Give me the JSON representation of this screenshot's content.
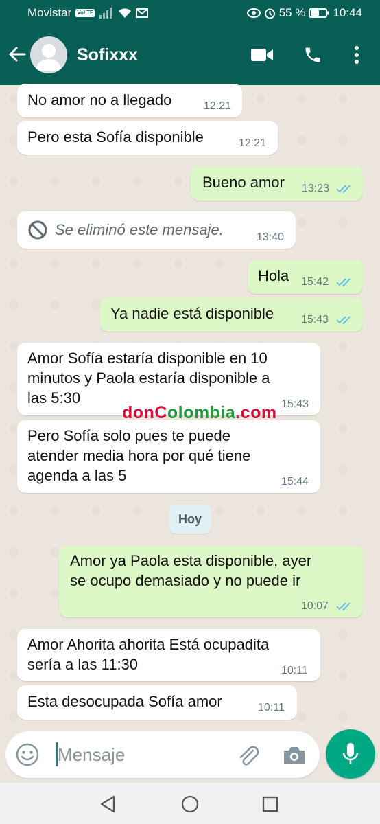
{
  "status_bar": {
    "carrier": "Movistar",
    "network_badge": "VoLTE",
    "battery_percent": "55 %",
    "time": "10:44",
    "icons": [
      "signal-icon",
      "wifi-icon",
      "mail-icon",
      "eye-icon",
      "alarm-icon",
      "battery-icon"
    ]
  },
  "header": {
    "contact_name": "Sofixxx",
    "icons": [
      "back-arrow-icon",
      "avatar-icon",
      "video-call-icon",
      "phone-icon",
      "more-vert-icon"
    ]
  },
  "messages": [
    {
      "text": "No amor no a llegado",
      "time": "12:21",
      "direction": "in"
    },
    {
      "text": "Pero esta Sofía disponible",
      "time": "12:21",
      "direction": "in"
    },
    {
      "text": "Bueno amor",
      "time": "13:23",
      "direction": "out",
      "status": "read"
    },
    {
      "text": "Se eliminó este mensaje.",
      "time": "13:40",
      "direction": "in",
      "deleted": true
    },
    {
      "text": "Hola",
      "time": "15:42",
      "direction": "out",
      "status": "read"
    },
    {
      "text": "Ya nadie está disponible",
      "time": "15:43",
      "direction": "out",
      "status": "read"
    },
    {
      "lines": [
        "Amor Sofía estaría disponible en 10",
        "minutos y Paola estaría disponible a",
        "las 5:30"
      ],
      "time": "15:43",
      "direction": "in"
    },
    {
      "lines": [
        "Pero Sofía solo pues te puede",
        "atender media hora por qué tiene",
        "agenda a las 5"
      ],
      "time": "15:44",
      "direction": "in"
    },
    {
      "lines": [
        "Amor ya Paola esta disponible, ayer",
        "se ocupo demasiado y no puede ir"
      ],
      "time": "10:07",
      "direction": "out",
      "status": "read"
    },
    {
      "lines": [
        "Amor Ahorita ahorita Está ocupadita",
        "sería a las 11:30"
      ],
      "time": "10:11",
      "direction": "in"
    },
    {
      "text": "Esta desocupada Sofía amor",
      "time": "10:11",
      "direction": "in"
    }
  ],
  "day_separator": "Hoy",
  "watermark": {
    "part1": "donC",
    "part2": "olombia",
    "part3": ".com"
  },
  "input": {
    "placeholder": "Mensaje",
    "value": ""
  },
  "colors": {
    "header": "#075e54",
    "outgoing_bubble": "#dcf8c6",
    "incoming_bubble": "#ffffff",
    "read_ticks": "#53bdeb",
    "mic_button": "#00a884",
    "chat_background": "#ece5dd"
  }
}
